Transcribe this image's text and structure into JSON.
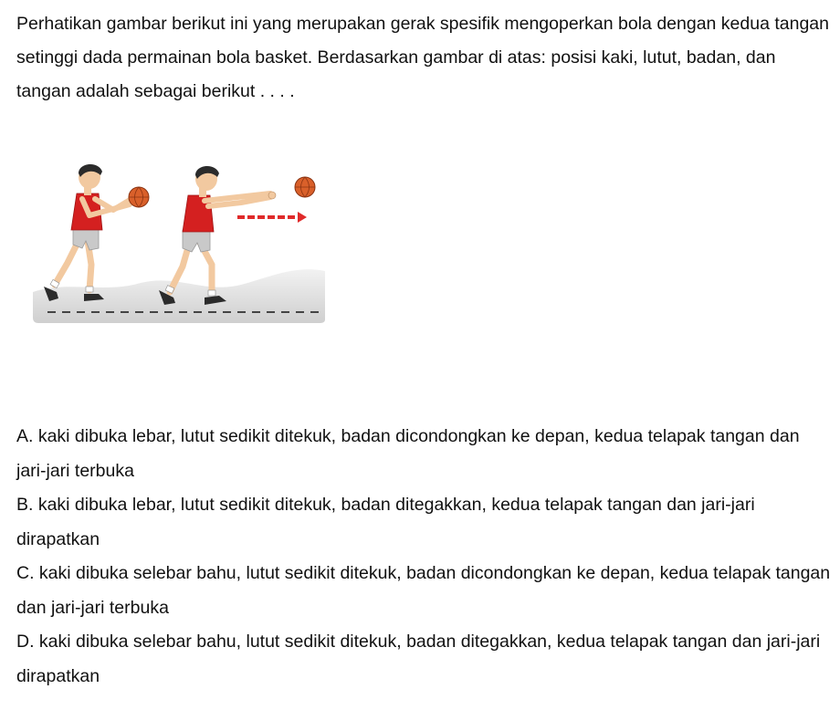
{
  "question": {
    "text": "Perhatikan gambar berikut ini yang merupakan gerak spesifik mengoperkan bola dengan kedua tangan setinggi dada permainan bola basket. Berdasarkan gambar di atas: posisi kaki, lutut, badan, dan tangan adalah sebagai berikut . . . ."
  },
  "illustration": {
    "icon": "basketball-chest-pass-illustration",
    "colors": {
      "jersey": "#d42020",
      "shorts": "#c9c9c9",
      "ball": "#d9602a",
      "arrow": "#e02a2a",
      "ground": "#d6d6d6",
      "skin": "#f2c9a0"
    }
  },
  "options": [
    {
      "text": "A. kaki dibuka lebar, lutut sedikit ditekuk, badan dicondongkan ke depan, kedua telapak tangan dan jari-jari terbuka"
    },
    {
      "text": "B. kaki dibuka lebar, lutut sedikit ditekuk, badan ditegakkan, kedua telapak tangan dan jari-jari dirapatkan"
    },
    {
      "text": "C. kaki dibuka selebar bahu, lutut sedikit ditekuk, badan dicondongkan ke depan, kedua telapak tangan dan jari-jari terbuka"
    },
    {
      "text": "D. kaki dibuka selebar bahu, lutut sedikit ditekuk, badan ditegakkan, kedua telapak tangan dan jari-jari dirapatkan"
    }
  ]
}
